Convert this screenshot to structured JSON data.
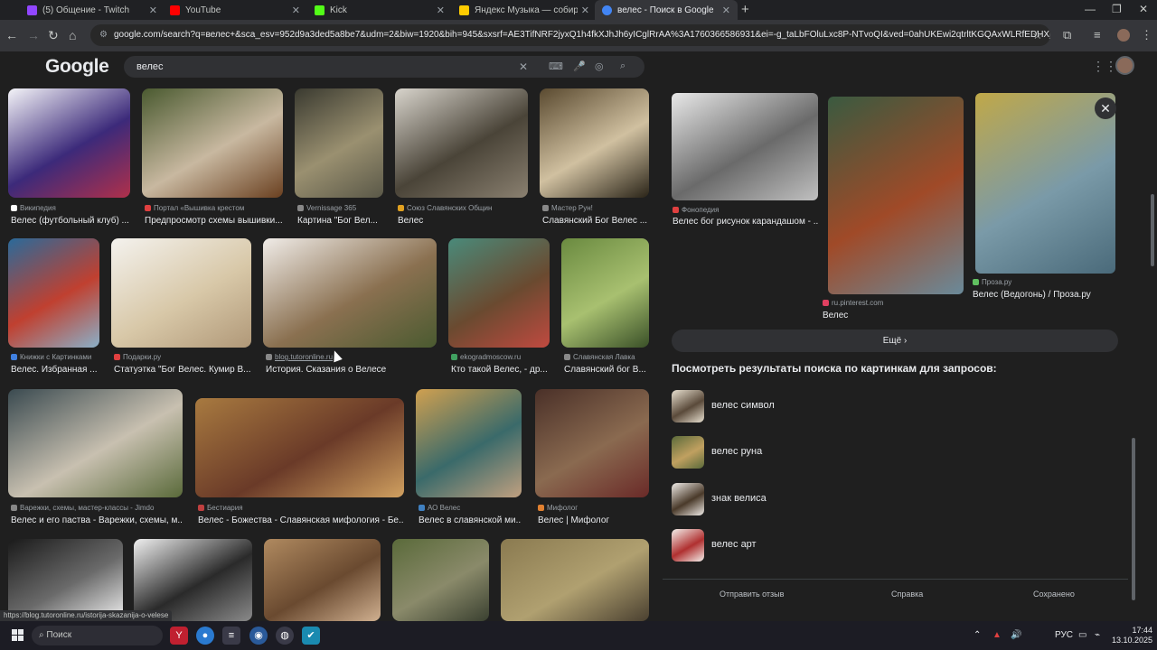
{
  "browser": {
    "tabs": [
      {
        "title": "(5) Общение - Twitch",
        "color": "#9146ff"
      },
      {
        "title": "YouTube",
        "color": "#ff0000"
      },
      {
        "title": "Kick",
        "color": "#53fc18"
      },
      {
        "title": "Яндекс Музыка — собираем музыку",
        "color": "#ffcc00"
      },
      {
        "title": "велес - Поиск в Google",
        "color": "#4285f4"
      }
    ],
    "new_tab_glyph": "+",
    "url": "google.com/search?q=велес+&sca_esv=952d9a3ded5a8be7&udm=2&biw=1920&bih=945&sxsrf=AE3TifNRF2jyxQ1h4fkXJhJh6yICglRrAA%3A1760366586931&ei=-g_taLbFOluLxc8P-NTvoQI&ved=0ahUKEwi2qtrltKGQAxWLRfEDHXjqOyQQ4d..."
  },
  "google": {
    "logo": "Google",
    "query": "велес"
  },
  "results": [
    {
      "source": "Википедия",
      "title": "Велес (футбольный клуб) ...",
      "src_color": "#ffffff",
      "colors": [
        "#f4f4f8",
        "#3c2a7a",
        "#b0304a"
      ]
    },
    {
      "source": "Портал «Вышивка крестом",
      "title": "Предпросмотр схемы вышивки...",
      "src_color": "#e04040",
      "colors": [
        "#4a5a30",
        "#c8b8a0",
        "#6a4020"
      ]
    },
    {
      "source": "Vernissage 365",
      "title": "Картина \"Бог Вел...",
      "src_color": "#888888",
      "colors": [
        "#3a3a30",
        "#9a9070",
        "#5a5848"
      ]
    },
    {
      "source": "Союз Славянских Общин",
      "title": "Велес",
      "src_color": "#e0a020",
      "colors": [
        "#d8d4cc",
        "#4a4438",
        "#8a8070"
      ]
    },
    {
      "source": "Мастер Рун!",
      "title": "Славянский Бог Велес ...",
      "src_color": "#888888",
      "colors": [
        "#5a4a30",
        "#d0c0a0",
        "#2a2418"
      ]
    },
    {
      "source": "Книжки с Картинками",
      "title": "Велес. Избранная ...",
      "src_color": "#4080e0",
      "colors": [
        "#2a6a9a",
        "#c04030",
        "#8ab0c8"
      ]
    },
    {
      "source": "Подарки.ру",
      "title": "Статуэтка \"Бог Велес. Кумир В...",
      "src_color": "#e04040",
      "colors": [
        "#f4f2ee",
        "#d8c8a8",
        "#b09878"
      ]
    },
    {
      "source": "blog.tutoronline.ru",
      "title": "История. Сказания о Велесе",
      "src_color": "#888888",
      "colors": [
        "#f0ece8",
        "#8a7050",
        "#4a5a30"
      ]
    },
    {
      "source": "ekogradmoscow.ru",
      "title": "Кто такой Велес, - др...",
      "src_color": "#40a060",
      "colors": [
        "#4a8a7a",
        "#6a4a30",
        "#c04a40"
      ]
    },
    {
      "source": "Славянская Лавка",
      "title": "Славянский бог В...",
      "src_color": "#888888",
      "colors": [
        "#6a8a40",
        "#a8c070",
        "#3a5028"
      ]
    },
    {
      "source": "Варежки, схемы, мастер-классы - Jimdo",
      "title": "Велес и его паства - Варежки, схемы, м...",
      "src_color": "#888888",
      "colors": [
        "#3a4a50",
        "#c8c0b0",
        "#5a6a3a"
      ]
    },
    {
      "source": "Бестиария",
      "title": "Велес - Божества - Славянская мифология - Бе...",
      "src_color": "#c04040",
      "colors": [
        "#a87a40",
        "#6a3a28",
        "#d0a060"
      ]
    },
    {
      "source": "АО Велес",
      "title": "Велес в славянской ми...",
      "src_color": "#4080c0",
      "colors": [
        "#d0a050",
        "#3a6a6a",
        "#c0a080"
      ]
    },
    {
      "source": "Мифолог",
      "title": "Велес | Мифолог",
      "src_color": "#e08030",
      "colors": [
        "#4a3028",
        "#8a6a50",
        "#6a2a28"
      ]
    },
    {
      "source": "",
      "title": "",
      "src_color": "#888888",
      "colors": [
        "#1a1a1a",
        "#6a6a6a",
        "#f0f0f0"
      ]
    },
    {
      "source": "",
      "title": "",
      "src_color": "#888888",
      "colors": [
        "#f0f0f0",
        "#2a2a2a",
        "#8a8a8a"
      ]
    },
    {
      "source": "",
      "title": "",
      "src_color": "#888888",
      "colors": [
        "#b08a60",
        "#6a4a30",
        "#d0b090"
      ]
    },
    {
      "source": "",
      "title": "",
      "src_color": "#888888",
      "colors": [
        "#5a6a3a",
        "#8a8a6a",
        "#3a4030"
      ]
    },
    {
      "source": "",
      "title": "",
      "src_color": "#888888",
      "colors": [
        "#8a7a50",
        "#b0a070",
        "#4a4030"
      ]
    }
  ],
  "panel": {
    "close_glyph": "✕",
    "images": [
      {
        "source": "Фонопедия",
        "title": "Велес бог рисунок карандашом - ...",
        "src_color": "#e04040",
        "colors": [
          "#e8e8e8",
          "#6a6a6a",
          "#c0c0c0"
        ]
      },
      {
        "source": "ru.pinterest.com",
        "title": "Велес",
        "src_color": "#e04060",
        "colors": [
          "#3a5a40",
          "#a04a28",
          "#6a8a9a"
        ]
      },
      {
        "source": "Проза.ру",
        "title": "Велес (Ведогонь) / Проза.ру",
        "src_color": "#60c060",
        "colors": [
          "#c0a848",
          "#7a9aa8",
          "#4a6a7a"
        ]
      }
    ],
    "more_label": "Ещё",
    "related_heading": "Посмотреть результаты поиска по картинкам для запросов:",
    "related": [
      {
        "label": "велес символ",
        "colors": [
          "#e8e0d0",
          "#5a4a3a"
        ]
      },
      {
        "label": "велес руна",
        "colors": [
          "#5a6a3a",
          "#c0a060"
        ]
      },
      {
        "label": "знак велиса",
        "colors": [
          "#f0ece8",
          "#4a3a2a"
        ]
      },
      {
        "label": "велес арт",
        "colors": [
          "#f4f0ec",
          "#b03030"
        ]
      }
    ],
    "footer_links": [
      "Отправить отзыв",
      "Справка",
      "Сохранено"
    ]
  },
  "status_url": "https://blog.tutoronline.ru/istorija-skazanija-o-velese",
  "taskbar": {
    "search_label": "Поиск",
    "lang": "РУС",
    "time": "17:44",
    "date": "13.10.2025"
  }
}
